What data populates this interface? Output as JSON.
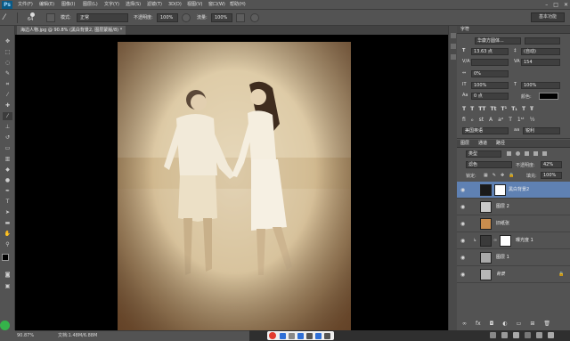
{
  "app": {
    "logo": "Ps",
    "menus": [
      "文件(F)",
      "编辑(E)",
      "图像(I)",
      "图层(L)",
      "文字(Y)",
      "选择(S)",
      "滤镜(T)",
      "3D(D)",
      "视图(V)",
      "窗口(W)",
      "帮助(H)"
    ]
  },
  "options": {
    "size": "64",
    "mode_label": "模式:",
    "mode_value": "正常",
    "opacity_label": "不透明度:",
    "opacity_value": "100%",
    "flow_label": "流量:",
    "flow_value": "100%",
    "workspace": "基本功能"
  },
  "document": {
    "tab": "海边人物.jpg @ 90.8% (黑白背景2, 图层蒙版/8) *",
    "zoom": "90.87%",
    "docsize": "文档:1.48M/6.88M"
  },
  "character": {
    "tab": "字符",
    "font": "华康方圆体...",
    "size": "13.63 点",
    "leading": "(自动)",
    "tracking": "154",
    "kern": "0%",
    "vscale": "100%",
    "hscale": "100%",
    "baseline": "0 点",
    "color_label": "颜色:",
    "lang": "美国英语",
    "aa": "锐利"
  },
  "layers": {
    "tabs": [
      "图层",
      "通道",
      "路径"
    ],
    "kind": "类型",
    "blend": "滤色",
    "opacity_label": "不透明度:",
    "opacity": "42%",
    "lock_label": "锁定:",
    "fill_label": "填充:",
    "fill": "100%",
    "items": [
      {
        "name": "黑白背景2",
        "selected": true
      },
      {
        "name": "图层 2"
      },
      {
        "name": "旧纸张"
      },
      {
        "name": "曝光度 1"
      },
      {
        "name": "图层 1"
      },
      {
        "name": "背景"
      }
    ]
  },
  "colors": {
    "accent": "#5f81b3",
    "taskbar": "#2f2f2f"
  }
}
